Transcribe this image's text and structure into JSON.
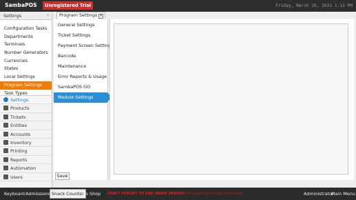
{
  "titlebar": {
    "brand": "SambaPOS",
    "trial_badge": "Unregistered Trial",
    "clock": "Friday, March 26, 2021 1:13 PM"
  },
  "sidebar": {
    "header": "Settings",
    "collapse_glyph": "‹",
    "items": [
      {
        "label": "Configuration Tasks"
      },
      {
        "label": "Departments"
      },
      {
        "label": "Terminals"
      },
      {
        "label": "Number Generators"
      },
      {
        "label": "Currencies"
      },
      {
        "label": "States"
      },
      {
        "label": "Local Settings"
      },
      {
        "label": "Program Settings",
        "selected": true
      },
      {
        "label": "Task Types"
      }
    ],
    "nav": [
      {
        "label": "Settings",
        "icon": "gear-icon",
        "selected": true
      },
      {
        "label": "Products",
        "icon": "products-icon"
      },
      {
        "label": "Tickets",
        "icon": "tickets-icon"
      },
      {
        "label": "Entities",
        "icon": "entities-icon"
      },
      {
        "label": "Accounts",
        "icon": "accounts-icon"
      },
      {
        "label": "Inventory",
        "icon": "inventory-icon"
      },
      {
        "label": "Printing",
        "icon": "printer-icon"
      },
      {
        "label": "Reports",
        "icon": "reports-icon"
      },
      {
        "label": "Automation",
        "icon": "automation-icon"
      },
      {
        "label": "Users",
        "icon": "users-icon"
      }
    ]
  },
  "document_tab": {
    "label": "Program Settings",
    "close_glyph": "×"
  },
  "settings_list": [
    {
      "label": "General Settings"
    },
    {
      "label": "Ticket Settings"
    },
    {
      "label": "Payment Screen Settings"
    },
    {
      "label": "Barcode"
    },
    {
      "label": "Maintenance"
    },
    {
      "label": "Error Reports & Usage"
    },
    {
      "label": "SambaPOS GO"
    },
    {
      "label": "Module Settings",
      "selected": true
    }
  ],
  "save_label": "Save",
  "bottombar": {
    "left_buttons": [
      "Keyboard",
      "Admissions",
      "Snack Counter",
      "Pro Shop"
    ],
    "active_button": "Snack Counter",
    "warning": "DON'T FORGET TO END WORK PERIOD!",
    "warning_detail": "Message Server not Connected",
    "user": "Administrator",
    "main_menu": "Main Menu"
  },
  "colors": {
    "accent_orange": "#f07b05",
    "selection_blue": "#2b8fd6",
    "trial_red": "#c9302c",
    "warning_red": "#e0201b"
  }
}
